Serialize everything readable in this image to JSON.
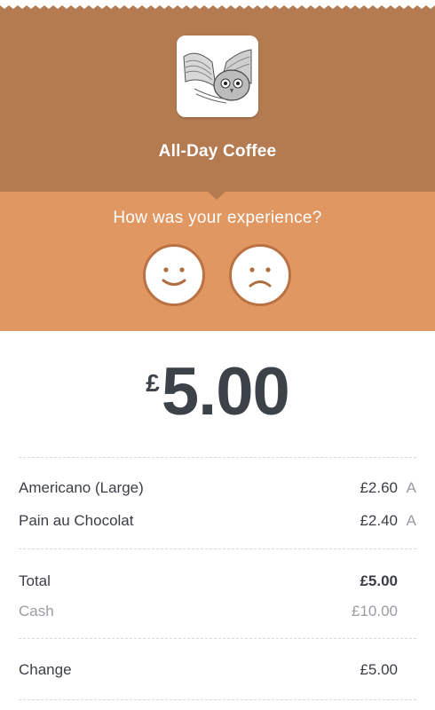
{
  "merchant": {
    "name": "All-Day Coffee",
    "logo_icon": "owl-logo-icon"
  },
  "feedback": {
    "prompt": "How was your experience?",
    "positive_icon": "smiley-face-icon",
    "negative_icon": "frowning-face-icon"
  },
  "amount": {
    "currency": "£",
    "value": "5.00"
  },
  "items": [
    {
      "name": "Americano (Large)",
      "price": "£2.60",
      "tax": "A"
    },
    {
      "name": "Pain au Chocolat",
      "price": "£2.40",
      "tax": "A"
    }
  ],
  "totals": {
    "total_label": "Total",
    "total_value": "£5.00",
    "cash_label": "Cash",
    "cash_value": "£10.00",
    "change_label": "Change",
    "change_value": "£5.00"
  },
  "colors": {
    "header": "#b47a50",
    "feedback_band": "#e09762",
    "face_ring": "#ba7244",
    "text_dark": "#3a3f46",
    "text_muted": "#9a9da2"
  }
}
